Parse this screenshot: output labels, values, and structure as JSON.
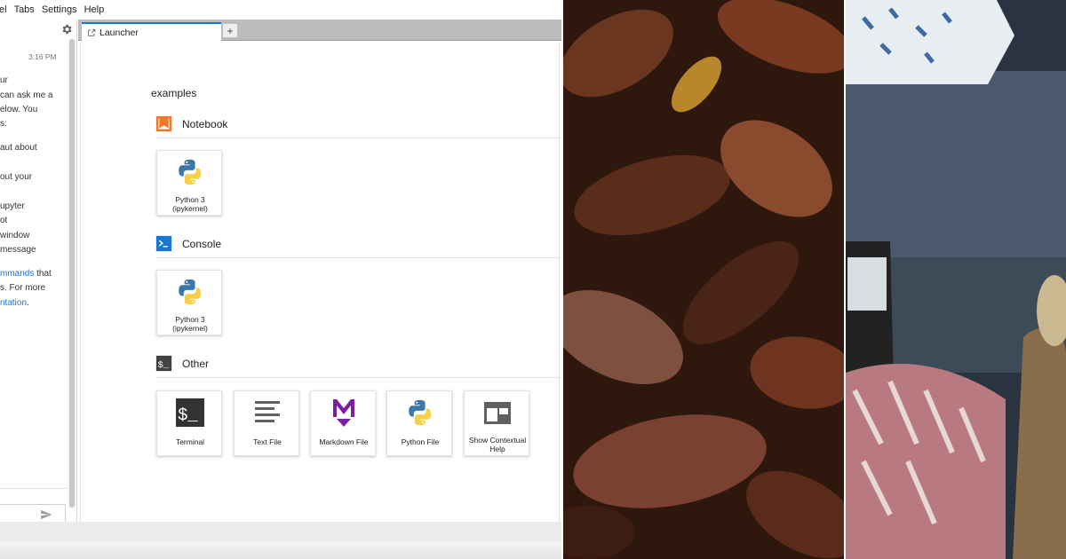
{
  "menubar": {
    "items": [
      "el",
      "Tabs",
      "Settings",
      "Help"
    ]
  },
  "chat": {
    "timestamp": "3:16 PM",
    "lines": [
      {
        "text": "ur",
        "link": false
      },
      {
        "text": "can ask me a",
        "link": false
      },
      {
        "text": "elow. You",
        "link": false
      },
      {
        "text": "s:",
        "link": false
      },
      {
        "text": "aut about",
        "link": false
      },
      {
        "text": "out your",
        "link": false
      },
      {
        "text": "upyter",
        "link": false
      },
      {
        "text": "ot",
        "link": false
      },
      {
        "text": "window",
        "link": false
      },
      {
        "text": "message",
        "link": false
      },
      {
        "text": "mmands",
        "link": true,
        "suffix": " that"
      },
      {
        "text": "s. For more",
        "link": false
      },
      {
        "text": "ntation",
        "link": true,
        "suffix": "."
      }
    ]
  },
  "tabs": {
    "active_label": "Launcher",
    "add_label": "+"
  },
  "launcher": {
    "cwd": "examples",
    "sections": [
      {
        "title": "Notebook",
        "icon": "notebook-icon",
        "color": "#f37726"
      },
      {
        "title": "Console",
        "icon": "console-icon",
        "color": "#1976d2"
      },
      {
        "title": "Other",
        "icon": "terminal-small-icon",
        "color": "#424242"
      }
    ],
    "notebook_cards": [
      {
        "label": "Python 3 (ipykernel)",
        "icon": "python-logo-icon"
      }
    ],
    "console_cards": [
      {
        "label": "Python 3 (ipykernel)",
        "icon": "python-logo-icon"
      }
    ],
    "other_cards": [
      {
        "label": "Terminal",
        "icon": "terminal-icon"
      },
      {
        "label": "Text File",
        "icon": "text-file-icon"
      },
      {
        "label": "Markdown File",
        "icon": "markdown-icon"
      },
      {
        "label": "Python File",
        "icon": "python-logo-icon"
      },
      {
        "label": "Show Contextual Help",
        "icon": "contextual-help-icon"
      }
    ]
  },
  "colors": {
    "accent_blue": "#1976d2",
    "notebook_orange": "#f37726",
    "markdown_purple": "#7b1fa2",
    "python_blue": "#3b77a8",
    "python_yellow": "#f7d04a"
  }
}
